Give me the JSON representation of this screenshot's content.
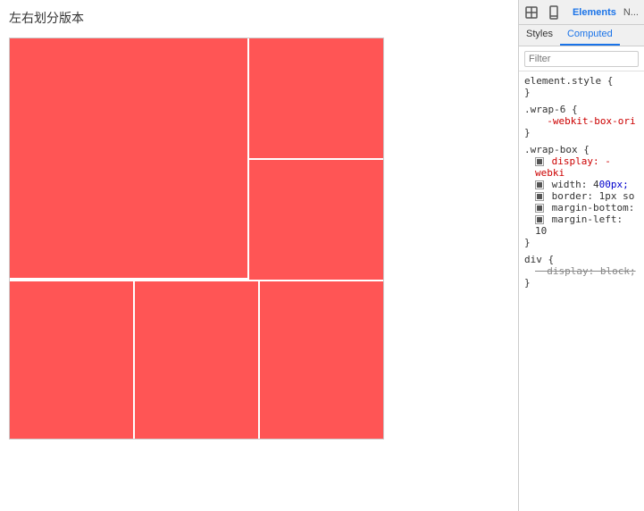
{
  "page": {
    "title": "左右划分版本"
  },
  "devtools": {
    "tabs": [
      {
        "id": "elements",
        "label": "Elements",
        "active": true
      },
      {
        "id": "network",
        "label": "N..."
      }
    ],
    "subtabs": [
      {
        "id": "styles",
        "label": "Styles",
        "active": false
      },
      {
        "id": "computed",
        "label": "Computed",
        "active": true
      }
    ],
    "filter": {
      "placeholder": "Filter"
    },
    "rules": [
      {
        "selector": "element.style {",
        "properties": [],
        "close": "}"
      },
      {
        "selector": ".wrap-6 {",
        "properties": [
          {
            "name": "-webkit-box-ori",
            "value": "",
            "color": "red",
            "checked": false
          }
        ],
        "close": "}"
      },
      {
        "selector": ".wrap-box {",
        "properties": [
          {
            "name": "display:",
            "value": "-webki",
            "color": "red",
            "checked": true
          },
          {
            "name": "width:",
            "value": "400px;",
            "color": "normal",
            "checked": true
          },
          {
            "name": "border:",
            "value": "1px so",
            "color": "normal",
            "checked": true
          },
          {
            "name": "margin-bottom:",
            "value": "",
            "color": "normal",
            "checked": true
          },
          {
            "name": "margin-left:",
            "value": "10",
            "color": "normal",
            "checked": true
          }
        ],
        "close": "}"
      },
      {
        "selector": "div {",
        "properties": [
          {
            "name": "display: block;",
            "value": "",
            "color": "strikethrough",
            "checked": false
          }
        ],
        "close": "}"
      }
    ]
  }
}
